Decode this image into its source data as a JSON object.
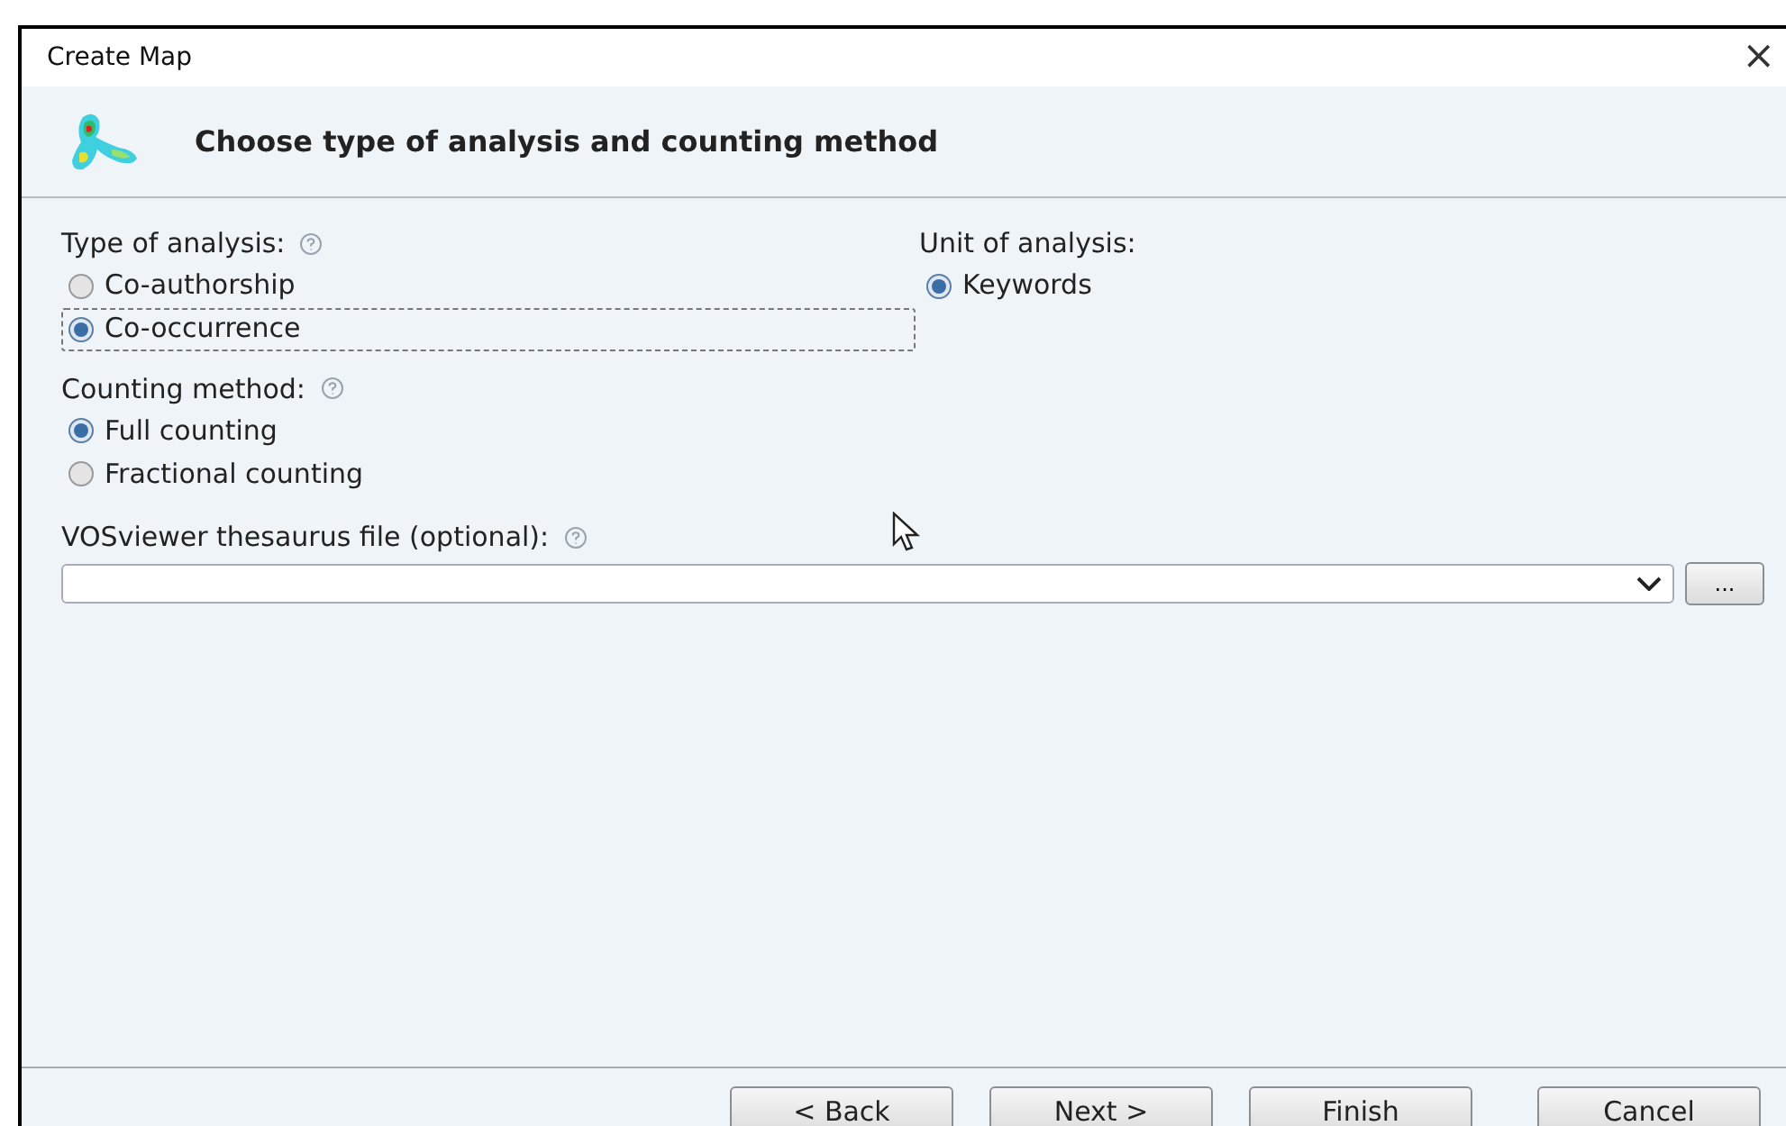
{
  "window": {
    "title": "Create Map",
    "close": "×"
  },
  "header": {
    "title": "Choose type of analysis and counting method"
  },
  "type_of_analysis": {
    "label": "Type of analysis:",
    "options": [
      {
        "label": "Co-authorship",
        "selected": false,
        "focused": false
      },
      {
        "label": "Co-occurrence",
        "selected": true,
        "focused": true
      }
    ]
  },
  "unit_of_analysis": {
    "label": "Unit of analysis:",
    "options": [
      {
        "label": "Keywords",
        "selected": true,
        "focused": false
      }
    ]
  },
  "counting_method": {
    "label": "Counting method:",
    "options": [
      {
        "label": "Full counting",
        "selected": true,
        "focused": false
      },
      {
        "label": "Fractional counting",
        "selected": false,
        "focused": false
      }
    ]
  },
  "thesaurus": {
    "label": "VOSviewer thesaurus file (optional):",
    "browse": "..."
  },
  "buttons": [
    {
      "label": "< Back"
    },
    {
      "label": "Next >"
    },
    {
      "label": "Finish"
    },
    {
      "label": "Cancel"
    }
  ]
}
